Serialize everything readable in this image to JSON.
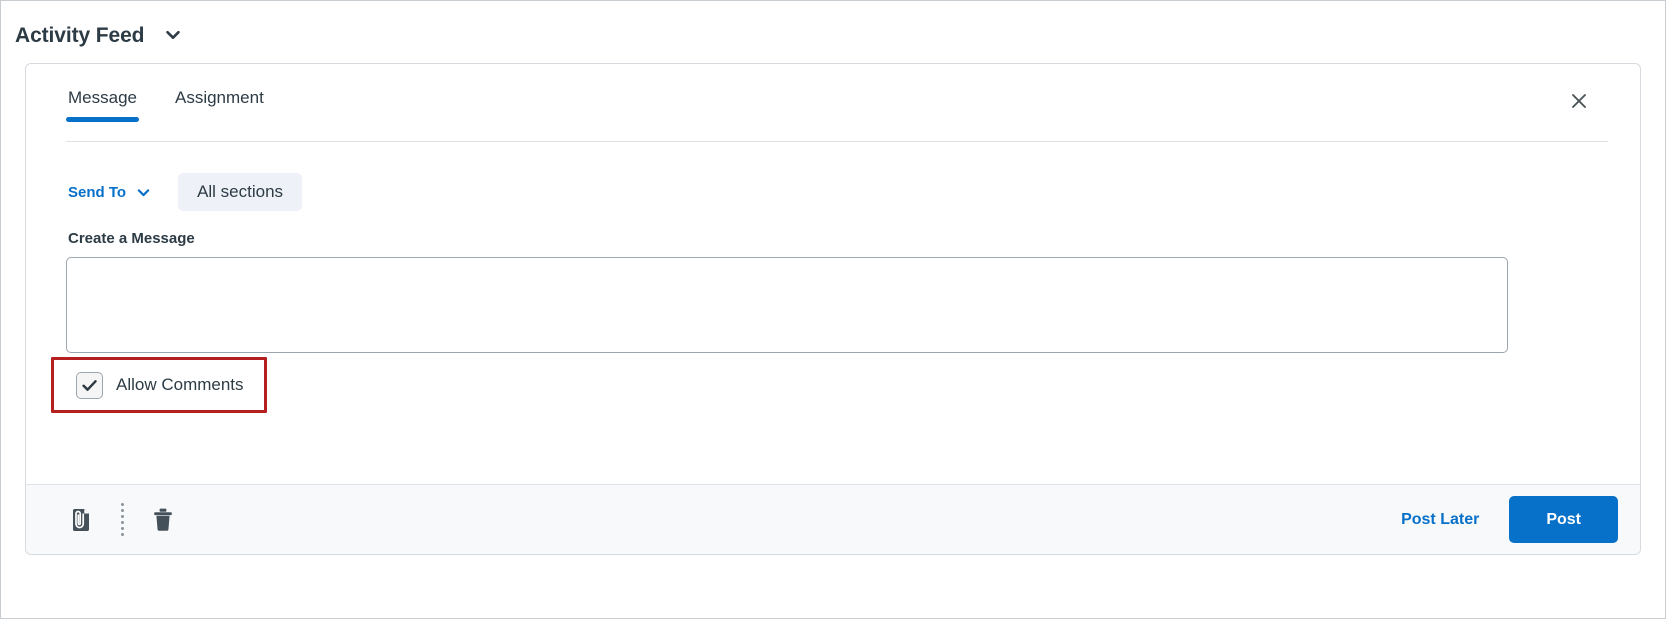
{
  "header": {
    "title": "Activity Feed",
    "chevron_icon": "chevron-down-icon"
  },
  "card": {
    "tabs": [
      {
        "label": "Message",
        "active": true
      },
      {
        "label": "Assignment",
        "active": false
      }
    ],
    "close_icon": "close-icon",
    "send_to": {
      "label": "Send To",
      "chevron_icon": "chevron-down-icon",
      "selected": "All sections"
    },
    "message": {
      "label": "Create a Message",
      "value": "",
      "placeholder": ""
    },
    "allow_comments": {
      "label": "Allow Comments",
      "checked": true,
      "highlight_color": "#b3201f"
    },
    "footer": {
      "attach_icon": "paperclip-icon",
      "divider_icon": "vertical-dots-divider-icon",
      "delete_icon": "trash-icon",
      "post_later_label": "Post Later",
      "post_label": "Post"
    }
  },
  "colors": {
    "accent": "#0770c8",
    "text": "#2d3b45",
    "highlight": "#b3201f",
    "pill_bg": "#eef2f8",
    "footer_bg": "#f8f9fb",
    "border": "#d6dade"
  }
}
